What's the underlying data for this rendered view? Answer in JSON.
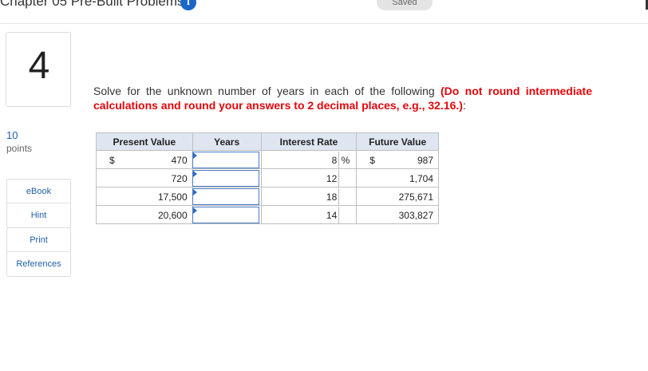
{
  "header": {
    "chapter_title": "Chapter 05 Pre-Built Problems",
    "info_icon_glyph": "i",
    "saved_label": "Saved"
  },
  "question": {
    "number": "4",
    "points_value": "10",
    "points_label": "points",
    "prompt": "Solve for the unknown number of years in each of the following",
    "instruction": "(Do not round intermediate calculations and round your answers to 2 decimal places, e.g., 32.16.)",
    "prompt_end": ":"
  },
  "sidebar": {
    "ebook": "eBook",
    "hint": "Hint",
    "print": "Print",
    "references": "References"
  },
  "table": {
    "headers": [
      "Present Value",
      "Years",
      "Interest Rate",
      "Future Value"
    ],
    "currency_symbol": "$",
    "percent_symbol": "%",
    "rows": [
      {
        "present_value": "470",
        "years": "",
        "rate": "8",
        "future_value": "987"
      },
      {
        "present_value": "720",
        "years": "",
        "rate": "12",
        "future_value": "1,704"
      },
      {
        "present_value": "17,500",
        "years": "",
        "rate": "18",
        "future_value": "275,671"
      },
      {
        "present_value": "20,600",
        "years": "",
        "rate": "14",
        "future_value": "303,827"
      }
    ]
  },
  "colors": {
    "accent_blue": "#1f5fa8",
    "instruction_red": "#e4060b",
    "header_fill": "#dfe6f2"
  }
}
